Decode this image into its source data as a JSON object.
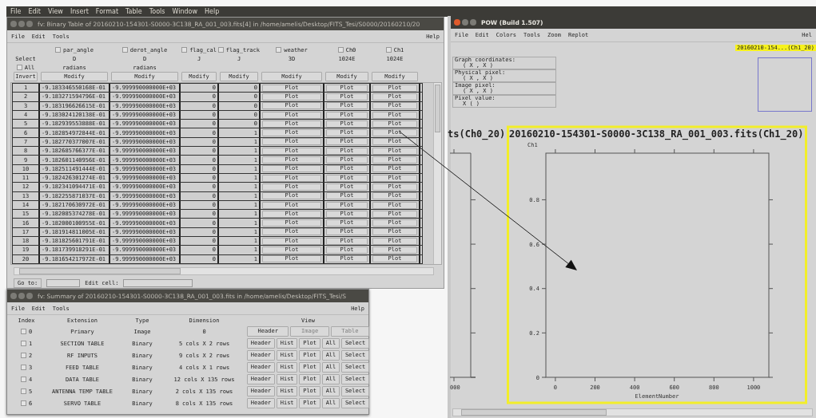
{
  "menubar": [
    "File",
    "Edit",
    "View",
    "Insert",
    "Format",
    "Table",
    "Tools",
    "Window",
    "Help"
  ],
  "table_window": {
    "title": "fv: Binary Table of 20160210-154301-S0000-3C138_RA_001_003.fits[4] in /home/amelis/Desktop/FITS_Tesi/S0000/20160210/20",
    "menu": [
      "File",
      "Edit",
      "Tools"
    ],
    "help": "Help",
    "select_label": "Select",
    "all_label": "All",
    "all_checked": false,
    "invert_label": "Invert",
    "columns": [
      {
        "name": "par_angle",
        "type": "D",
        "unit": "radians",
        "checked": false,
        "modify": "Modify"
      },
      {
        "name": "derot_angle",
        "type": "D",
        "unit": "radians",
        "checked": false,
        "modify": "Modify"
      },
      {
        "name": "flag_cal",
        "type": "J",
        "checked": false,
        "modify": "Modify"
      },
      {
        "name": "flag_track",
        "type": "J",
        "checked": false,
        "modify": "Modify"
      },
      {
        "name": "weather",
        "type": "3D",
        "checked": false,
        "modify": "Modify"
      },
      {
        "name": "Ch0",
        "type": "1024E",
        "checked": false,
        "modify": "Modify"
      },
      {
        "name": "Ch1",
        "type": "1024E",
        "checked": false,
        "modify": "Modify"
      }
    ],
    "rows": [
      {
        "index": "1",
        "cells": [
          "-9.183346550168E-01",
          "-9.999990000000E+03",
          "0",
          "0"
        ],
        "buttons": [
          "Plot",
          "Plot",
          "Plot"
        ]
      },
      {
        "index": "2",
        "cells": [
          "-9.183271594796E-01",
          "-9.999990000000E+03",
          "0",
          "0"
        ],
        "buttons": [
          "Plot",
          "Plot",
          "Plot"
        ]
      },
      {
        "index": "3",
        "cells": [
          "-9.183196626615E-01",
          "-9.999990000000E+03",
          "0",
          "0"
        ],
        "buttons": [
          "Plot",
          "Plot",
          "Plot"
        ]
      },
      {
        "index": "4",
        "cells": [
          "-9.183024120138E-01",
          "-9.999990000000E+03",
          "0",
          "0"
        ],
        "buttons": [
          "Plot",
          "Plot",
          "Plot"
        ]
      },
      {
        "index": "5",
        "cells": [
          "-9.182939553888E-01",
          "-9.999990000000E+03",
          "0",
          "0"
        ],
        "buttons": [
          "Plot",
          "Plot",
          "Plot"
        ]
      },
      {
        "index": "6",
        "cells": [
          "-9.182854972844E-01",
          "-9.999990000000E+03",
          "0",
          "1"
        ],
        "buttons": [
          "Plot",
          "Plot",
          "Plot"
        ]
      },
      {
        "index": "7",
        "cells": [
          "-9.182770377007E-01",
          "-9.999990000000E+03",
          "0",
          "1"
        ],
        "buttons": [
          "Plot",
          "Plot",
          "Plot"
        ]
      },
      {
        "index": "8",
        "cells": [
          "-9.182685766377E-01",
          "-9.999990000000E+03",
          "0",
          "1"
        ],
        "buttons": [
          "Plot",
          "Plot",
          "Plot"
        ]
      },
      {
        "index": "9",
        "cells": [
          "-9.182601140956E-01",
          "-9.999990000000E+03",
          "0",
          "1"
        ],
        "buttons": [
          "Plot",
          "Plot",
          "Plot"
        ]
      },
      {
        "index": "10",
        "cells": [
          "-9.182511491444E-01",
          "-9.999990000000E+03",
          "0",
          "1"
        ],
        "buttons": [
          "Plot",
          "Plot",
          "Plot"
        ]
      },
      {
        "index": "11",
        "cells": [
          "-9.182426301274E-01",
          "-9.999990000000E+03",
          "0",
          "1"
        ],
        "buttons": [
          "Plot",
          "Plot",
          "Plot"
        ]
      },
      {
        "index": "12",
        "cells": [
          "-9.182341094471E-01",
          "-9.999990000000E+03",
          "0",
          "1"
        ],
        "buttons": [
          "Plot",
          "Plot",
          "Plot"
        ]
      },
      {
        "index": "13",
        "cells": [
          "-9.182255871037E-01",
          "-9.999990000000E+03",
          "0",
          "1"
        ],
        "buttons": [
          "Plot",
          "Plot",
          "Plot"
        ]
      },
      {
        "index": "14",
        "cells": [
          "-9.182170630972E-01",
          "-9.999990000000E+03",
          "0",
          "1"
        ],
        "buttons": [
          "Plot",
          "Plot",
          "Plot"
        ]
      },
      {
        "index": "15",
        "cells": [
          "-9.182085374278E-01",
          "-9.999990000000E+03",
          "0",
          "1"
        ],
        "buttons": [
          "Plot",
          "Plot",
          "Plot"
        ]
      },
      {
        "index": "16",
        "cells": [
          "-9.182000100955E-01",
          "-9.999990000000E+03",
          "0",
          "1"
        ],
        "buttons": [
          "Plot",
          "Plot",
          "Plot"
        ]
      },
      {
        "index": "17",
        "cells": [
          "-9.181914811005E-01",
          "-9.999990000000E+03",
          "0",
          "1"
        ],
        "buttons": [
          "Plot",
          "Plot",
          "Plot"
        ]
      },
      {
        "index": "18",
        "cells": [
          "-9.181825601791E-01",
          "-9.999990000000E+03",
          "0",
          "1"
        ],
        "buttons": [
          "Plot",
          "Plot",
          "Plot"
        ]
      },
      {
        "index": "19",
        "cells": [
          "-9.181739918291E-01",
          "-9.999990000000E+03",
          "0",
          "1"
        ],
        "buttons": [
          "Plot",
          "Plot",
          "Plot"
        ]
      },
      {
        "index": "20",
        "cells": [
          "-9.181654217972E-01",
          "-9.999990000000E+03",
          "0",
          "1"
        ],
        "buttons": [
          "Plot",
          "Plot",
          "Plot"
        ]
      }
    ],
    "goto_label": "Go to:",
    "edit_cell_label": "Edit cell:"
  },
  "summary_window": {
    "title": "fv: Summary of 20160210-154301-S0000-3C138_RA_001_003.fits in /home/amelis/Desktop/FITS_Tesi/S",
    "menu": [
      "File",
      "Edit",
      "Tools"
    ],
    "help": "Help",
    "headers": [
      "Index",
      "Extension",
      "Type",
      "Dimension",
      "View"
    ],
    "rows": [
      {
        "index": "0",
        "checked": false,
        "extension": "Primary",
        "type": "Image",
        "dimension": "0",
        "buttons": [
          {
            "label": "Header",
            "disabled": false
          },
          {
            "label": "Image",
            "disabled": true
          },
          {
            "label": "Table",
            "disabled": true
          }
        ]
      },
      {
        "index": "1",
        "checked": false,
        "extension": "SECTION TABLE",
        "type": "Binary",
        "dimension": "5 cols X 2 rows",
        "buttons": [
          {
            "label": "Header",
            "disabled": false
          },
          {
            "label": "Hist",
            "disabled": false
          },
          {
            "label": "Plot",
            "disabled": false
          },
          {
            "label": "All",
            "disabled": false
          },
          {
            "label": "Select",
            "disabled": false
          }
        ]
      },
      {
        "index": "2",
        "checked": false,
        "extension": "RF INPUTS",
        "type": "Binary",
        "dimension": "9 cols X 2 rows",
        "buttons": [
          {
            "label": "Header",
            "disabled": false
          },
          {
            "label": "Hist",
            "disabled": false
          },
          {
            "label": "Plot",
            "disabled": false
          },
          {
            "label": "All",
            "disabled": false
          },
          {
            "label": "Select",
            "disabled": false
          }
        ]
      },
      {
        "index": "3",
        "checked": false,
        "extension": "FEED TABLE",
        "type": "Binary",
        "dimension": "4 cols X 1 rows",
        "buttons": [
          {
            "label": "Header",
            "disabled": false
          },
          {
            "label": "Hist",
            "disabled": false
          },
          {
            "label": "Plot",
            "disabled": false
          },
          {
            "label": "All",
            "disabled": false
          },
          {
            "label": "Select",
            "disabled": false
          }
        ]
      },
      {
        "index": "4",
        "checked": false,
        "extension": "DATA TABLE",
        "type": "Binary",
        "dimension": "12 cols X 135 rows",
        "buttons": [
          {
            "label": "Header",
            "disabled": false
          },
          {
            "label": "Hist",
            "disabled": false
          },
          {
            "label": "Plot",
            "disabled": false
          },
          {
            "label": "All",
            "disabled": false
          },
          {
            "label": "Select",
            "disabled": false
          }
        ]
      },
      {
        "index": "5",
        "checked": false,
        "extension": "ANTENNA TEMP TABLE",
        "type": "Binary",
        "dimension": "2 cols X 135 rows",
        "buttons": [
          {
            "label": "Header",
            "disabled": false
          },
          {
            "label": "Hist",
            "disabled": false
          },
          {
            "label": "Plot",
            "disabled": false
          },
          {
            "label": "All",
            "disabled": false
          },
          {
            "label": "Select",
            "disabled": false
          }
        ]
      },
      {
        "index": "6",
        "checked": false,
        "extension": "SERVO TABLE",
        "type": "Binary",
        "dimension": "8 cols X 135 rows",
        "buttons": [
          {
            "label": "Header",
            "disabled": false
          },
          {
            "label": "Hist",
            "disabled": false
          },
          {
            "label": "Plot",
            "disabled": false
          },
          {
            "label": "All",
            "disabled": false
          },
          {
            "label": "Select",
            "disabled": false
          }
        ]
      }
    ]
  },
  "pow_window": {
    "title": "POW (Build 1.507)",
    "menu": [
      "File",
      "Edit",
      "Colors",
      "Tools",
      "Zoom",
      "Replot"
    ],
    "help": "Hel",
    "graph_tag": "20160210-154...(Ch1_20)",
    "coordinates": [
      {
        "label": "Graph coordinates:",
        "value": "( X , X )"
      },
      {
        "label": "Physical pixel:",
        "value": "( X , X )"
      },
      {
        "label": "Image pixel:",
        "value": "( X , X )"
      },
      {
        "label": "Pixel value:",
        "value": "X ( )"
      }
    ],
    "left_graph": {
      "title_fragment": "ts(Ch0_20)",
      "tick_label": "000"
    },
    "chart_data": {
      "type": "line",
      "title": "20160210-154301-S0000-3C138_RA_001_003.fits(Ch1_20)",
      "xlabel": "ElementNumber",
      "ylabel": "Ch1",
      "xlim": [
        -48,
        1077
      ],
      "ylim": [
        0,
        1.01
      ],
      "xticks": [
        0,
        200,
        400,
        600,
        800,
        1000
      ],
      "yticks": [
        0,
        0.2,
        0.4,
        0.6,
        0.8
      ]
    }
  }
}
